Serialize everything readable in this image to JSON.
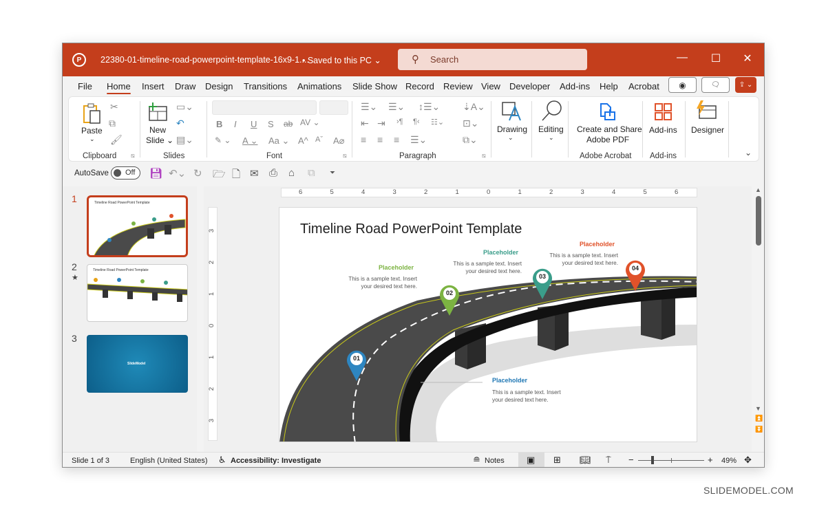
{
  "titlebar": {
    "doc_title": "22380-01-timeline-road-powerpoint-template-16x9-1....",
    "saved_status": "• Saved to this PC ⌄",
    "search_placeholder": "Search",
    "minimize": "—",
    "maximize": "☐",
    "close": "✕",
    "accent": "#c43e1c"
  },
  "menu": {
    "tabs": [
      "File",
      "Home",
      "Insert",
      "Draw",
      "Design",
      "Transitions",
      "Animations",
      "Slide Show",
      "Record",
      "Review",
      "View",
      "Developer",
      "Add-ins",
      "Help",
      "Acrobat"
    ],
    "active": "Home",
    "record_icon": "◉",
    "comment_icon": "🗨",
    "share_icon": "⇪ ⌄"
  },
  "ribbon": {
    "clipboard": {
      "label": "Clipboard",
      "paste": "Paste",
      "paste_arrow": "⌄"
    },
    "slides": {
      "label": "Slides",
      "new_slide_1": "New",
      "new_slide_2": "Slide ⌄"
    },
    "font": {
      "label": "Font",
      "bold": "B",
      "italic": "I",
      "underline": "U",
      "shadow": "S",
      "strike": "ab",
      "spacing": "AV ⌄",
      "highlight": "✎ ⌄",
      "color": "A ⌄",
      "case": "Aa ⌄",
      "grow": "A^",
      "shrink": "Aˇ",
      "clear": "A⌀"
    },
    "paragraph": {
      "label": "Paragraph"
    },
    "drawing": {
      "label": "Drawing",
      "arrow": "⌄"
    },
    "editing": {
      "label": "Editing",
      "arrow": "⌄"
    },
    "acrobat": {
      "button_1": "Create and Share",
      "button_2": "Adobe PDF",
      "label": "Adobe Acrobat"
    },
    "addins": {
      "button": "Add-ins",
      "label": "Add-ins"
    },
    "designer": {
      "button": "Designer"
    },
    "collapse": "⌄"
  },
  "qat": {
    "autosave_label": "AutoSave",
    "autosave_state": "Off"
  },
  "thumbnails": [
    {
      "num": "1",
      "selected": true,
      "title": "Timeline Road PowerPoint Template"
    },
    {
      "num": "2",
      "selected": false,
      "star": "★",
      "title": "Timeline Road PowerPoint Template"
    },
    {
      "num": "3",
      "selected": false,
      "brand": "SlideModel"
    }
  ],
  "ruler": {
    "h": [
      "6",
      "5",
      "4",
      "3",
      "2",
      "1",
      "0",
      "1",
      "2",
      "3",
      "4",
      "5",
      "6"
    ],
    "v": [
      "3",
      "2",
      "1",
      "0",
      "1",
      "2",
      "3"
    ]
  },
  "slide": {
    "title": "Timeline Road PowerPoint Template",
    "milestones": [
      {
        "num": "01",
        "heading": "Placeholder",
        "text_1": "This is a sample text. Insert",
        "text_2": "your desired text here.",
        "color": "#2e86c1"
      },
      {
        "num": "02",
        "heading": "Placeholder",
        "text_1": "This is a sample text. Insert",
        "text_2": "your desired text here.",
        "color": "#7cb342"
      },
      {
        "num": "03",
        "heading": "Placeholder",
        "text_1": "This is a sample text. Insert",
        "text_2": "your desired text here.",
        "color": "#3a9d8a"
      },
      {
        "num": "04",
        "heading": "Placeholder",
        "text_1": "This is a sample text. Insert",
        "text_2": "your desired text here.",
        "color": "#e0522a"
      }
    ]
  },
  "status": {
    "slide_count": "Slide 1 of 3",
    "language": "English (United States)",
    "accessibility": "Accessibility: Investigate",
    "notes": "Notes",
    "zoom_minus": "−",
    "zoom_plus": "+",
    "zoom": "49%",
    "zoom_fraction": 0.49
  },
  "watermark": "SLIDEMODEL.COM"
}
